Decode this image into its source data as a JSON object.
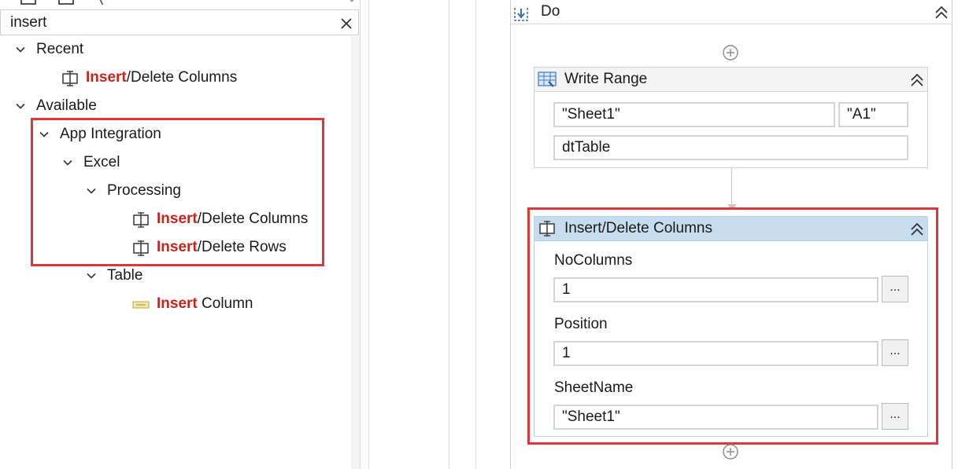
{
  "search": {
    "value": "insert"
  },
  "tree": {
    "recent": {
      "label": "Recent",
      "items": [
        {
          "highlight": "Insert",
          "rest": "/Delete Columns"
        }
      ]
    },
    "available": {
      "label": "Available",
      "app_integration": {
        "label": "App Integration",
        "excel": {
          "label": "Excel",
          "processing": {
            "label": "Processing",
            "items": [
              {
                "highlight": "Insert",
                "rest": "/Delete Columns"
              },
              {
                "highlight": "Insert",
                "rest": "/Delete Rows"
              }
            ]
          },
          "table": {
            "label": "Table",
            "items": [
              {
                "highlight": "Insert",
                "rest": " Column"
              }
            ]
          }
        }
      }
    }
  },
  "designer": {
    "do_label": "Do",
    "write_range": {
      "title": "Write Range",
      "sheet": "\"Sheet1\"",
      "cell": "\"A1\"",
      "datatable": "dtTable"
    },
    "insert_delete": {
      "title": "Insert/Delete Columns",
      "no_columns_label": "NoColumns",
      "no_columns_value": "1",
      "position_label": "Position",
      "position_value": "1",
      "sheet_name_label": "SheetName",
      "sheet_name_value": "\"Sheet1\"",
      "dots": "..."
    }
  },
  "colors": {
    "highlight_text": "#c8231c",
    "annotation_box": "#e0353a",
    "selected_header": "#c6ddf0"
  },
  "icons": {
    "search_clear": "close-icon",
    "chevron": "chevron-down-icon",
    "activity": "insert-delete-columns-icon",
    "table_activity": "insert-column-icon",
    "write_range": "write-range-icon",
    "collapse": "double-chevron-up-icon",
    "add": "add-circle-icon"
  }
}
